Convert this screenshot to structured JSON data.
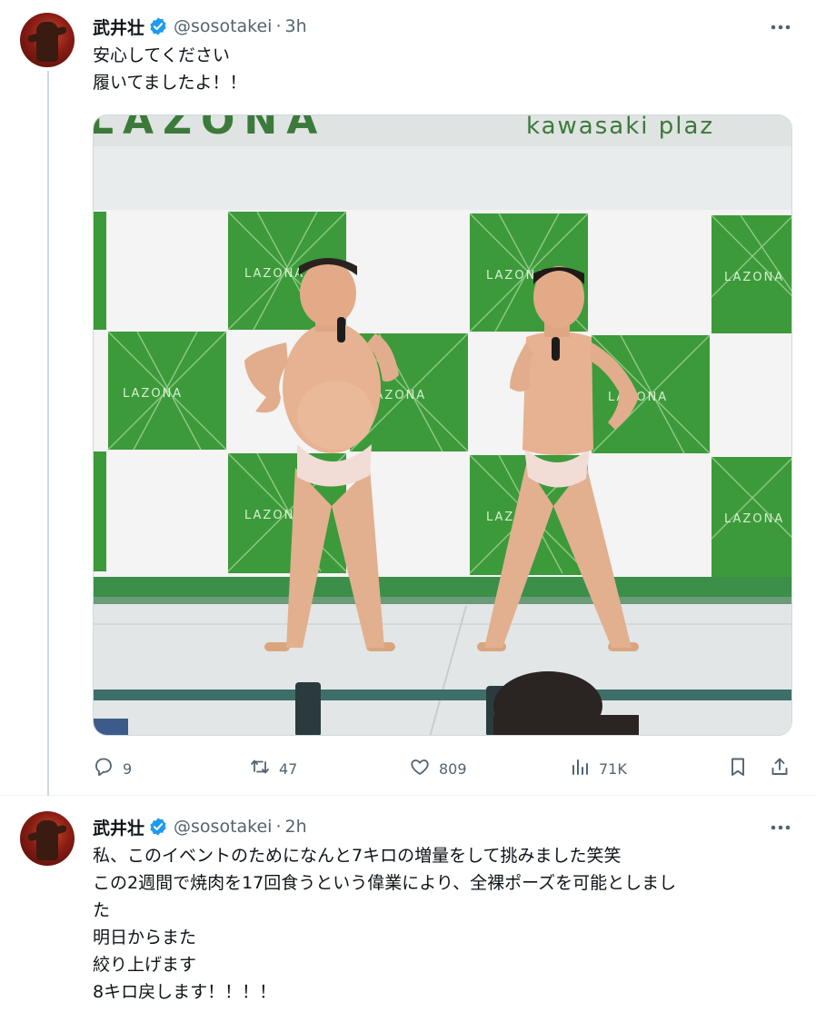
{
  "tweets": [
    {
      "name": "武井壮",
      "handle": "@sosotakei",
      "separator": "·",
      "time": "3h",
      "lines": [
        "安心してください",
        "履いてましたよ！！"
      ],
      "media": {
        "banner_text": "LAZONA",
        "banner_sub": "kawasaki plaz",
        "tile_text": "LAZONA"
      },
      "stats": {
        "replies": "9",
        "retweets": "47",
        "likes": "809",
        "views": "71K"
      }
    },
    {
      "name": "武井壮",
      "handle": "@sosotakei",
      "separator": "·",
      "time": "2h",
      "lines": [
        "私、このイベントのためになんと7キロの増量をして挑みました笑笑",
        "この2週間で焼肉を17回食うという偉業により、全裸ポーズを可能としまし",
        "た",
        "明日からまた",
        "絞り上げます",
        "8キロ戻します！！！！"
      ]
    }
  ],
  "icons": {
    "avatar": "avatar-photo",
    "verified": "verified-badge-icon",
    "more": "more-dots-icon",
    "reply": "reply-bubble-icon",
    "retweet": "retweet-icon",
    "like": "heart-icon",
    "views": "views-bars-icon",
    "bookmark": "bookmark-icon",
    "share": "share-icon"
  },
  "colors": {
    "text": "#0f1419",
    "secondary": "#536471",
    "verified": "#1d9bf0",
    "border": "#eff3f4",
    "stage_green": "#3c9a3a"
  }
}
